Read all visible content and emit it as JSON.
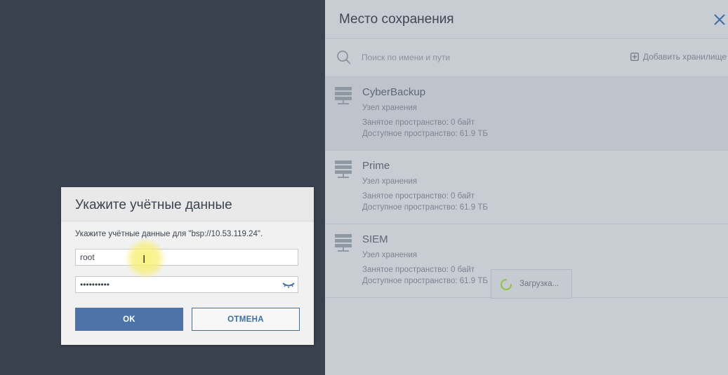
{
  "panel": {
    "title": "Место сохранения",
    "search_placeholder": "Поиск по имени и пути",
    "add_storage_label": "Добавить хранилище",
    "items": [
      {
        "name": "CyberBackup",
        "type": "Узел хранения",
        "used": "Занятое пространство: 0 байт",
        "free": "Доступное пространство: 61.9 ТБ",
        "icon": "server-icon"
      },
      {
        "name": "Prime",
        "type": "Узел хранения",
        "used": "Занятое пространство: 0 байт",
        "free": "Доступное пространство: 61.9 ТБ",
        "icon": "server-icon"
      },
      {
        "name": "SIEM",
        "type": "Узел хранения",
        "used": "Занятое пространство: 0 байт",
        "free": "Доступное пространство: 61.9 ТБ",
        "icon": "server-icon"
      }
    ]
  },
  "loading": {
    "label": "Загрузка..."
  },
  "dialog": {
    "title": "Укажите учётные данные",
    "description": "Укажите учётные данные для \"bsp://10.53.119.24\".",
    "username_value": "root",
    "password_value": "••••••••••",
    "ok_label": "OK",
    "cancel_label": "ОТМЕНА"
  },
  "colors": {
    "background": "#3a4250",
    "panel": "#c8ccd3",
    "accent": "#3d6fa8",
    "ok_button": "#4d73a9",
    "spinner": "#8cc63f"
  }
}
